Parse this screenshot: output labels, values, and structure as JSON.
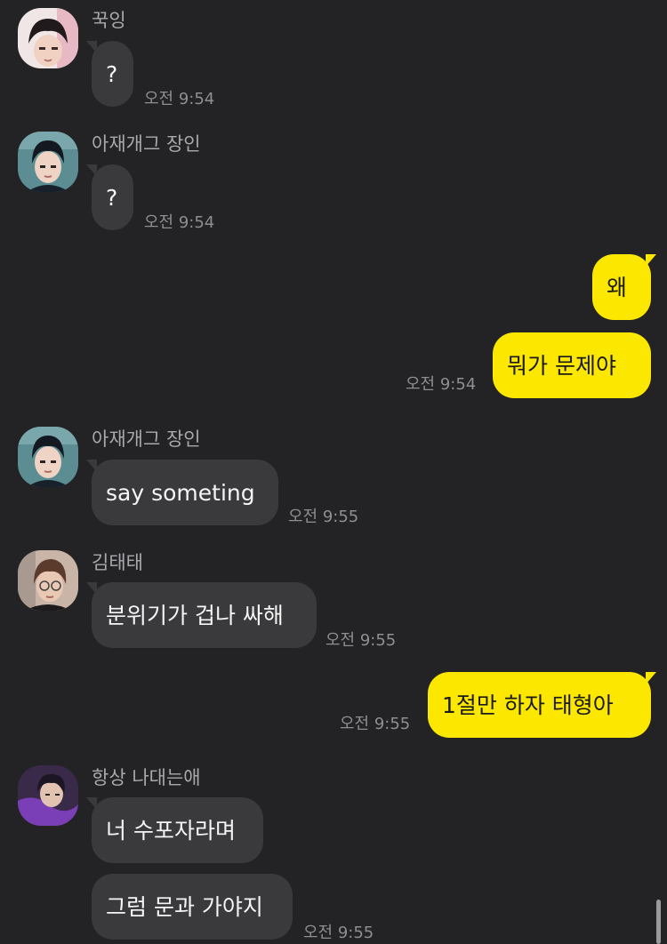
{
  "colors": {
    "background": "#232325",
    "incoming_bubble": "#3a3a3c",
    "outgoing_bubble": "#fce700",
    "sender_name": "#a9a9ad",
    "timestamp": "#8e8e93"
  },
  "messages": [
    {
      "sender": "꾹잉",
      "text": "?",
      "time": "오전 9:54"
    },
    {
      "sender": "아재개그 장인",
      "text": "?",
      "time": "오전 9:54"
    },
    {
      "outgoing": [
        "왜",
        "뭐가 문제야"
      ],
      "time": "오전 9:54"
    },
    {
      "sender": "아재개그 장인",
      "text": "say someting",
      "time": "오전 9:55"
    },
    {
      "sender": "김태태",
      "text": "분위기가 겁나 싸해",
      "time": "오전 9:55"
    },
    {
      "outgoing": [
        "1절만 하자 태형아"
      ],
      "time": "오전 9:55"
    },
    {
      "sender": "항상 나대는애",
      "texts": [
        "너 수포자라며",
        "그럼 문과 가야지"
      ],
      "time": "오전 9:55"
    }
  ]
}
